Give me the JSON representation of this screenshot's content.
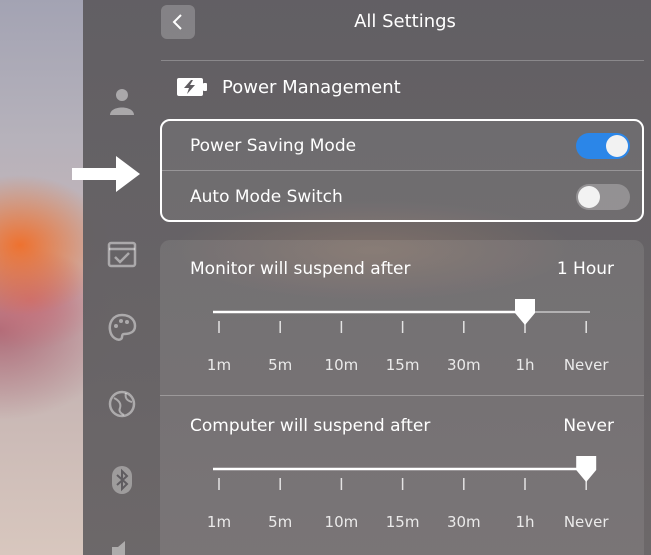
{
  "header": {
    "title": "All Settings",
    "back_icon": "chevron-left-icon"
  },
  "sidebar": {
    "icons": [
      "user-icon",
      "calendar-check-icon",
      "palette-icon",
      "globe-icon",
      "bluetooth-icon",
      "volume-icon"
    ]
  },
  "section": {
    "title": "Power Management",
    "icon": "battery-charging-icon"
  },
  "toggles": [
    {
      "label": "Power Saving Mode",
      "state": true
    },
    {
      "label": "Auto Mode Switch",
      "state": false
    }
  ],
  "monitor_suspend": {
    "label": "Monitor will suspend after",
    "value": "1 Hour",
    "selected_index": 5
  },
  "computer_suspend": {
    "label": "Computer will suspend after",
    "value": "Never",
    "selected_index": 6
  },
  "tick_labels": [
    "1m",
    "5m",
    "10m",
    "15m",
    "30m",
    "1h",
    "Never"
  ],
  "colors": {
    "toggle_on": "#2b86e8",
    "highlight_border": "#ffffff"
  }
}
